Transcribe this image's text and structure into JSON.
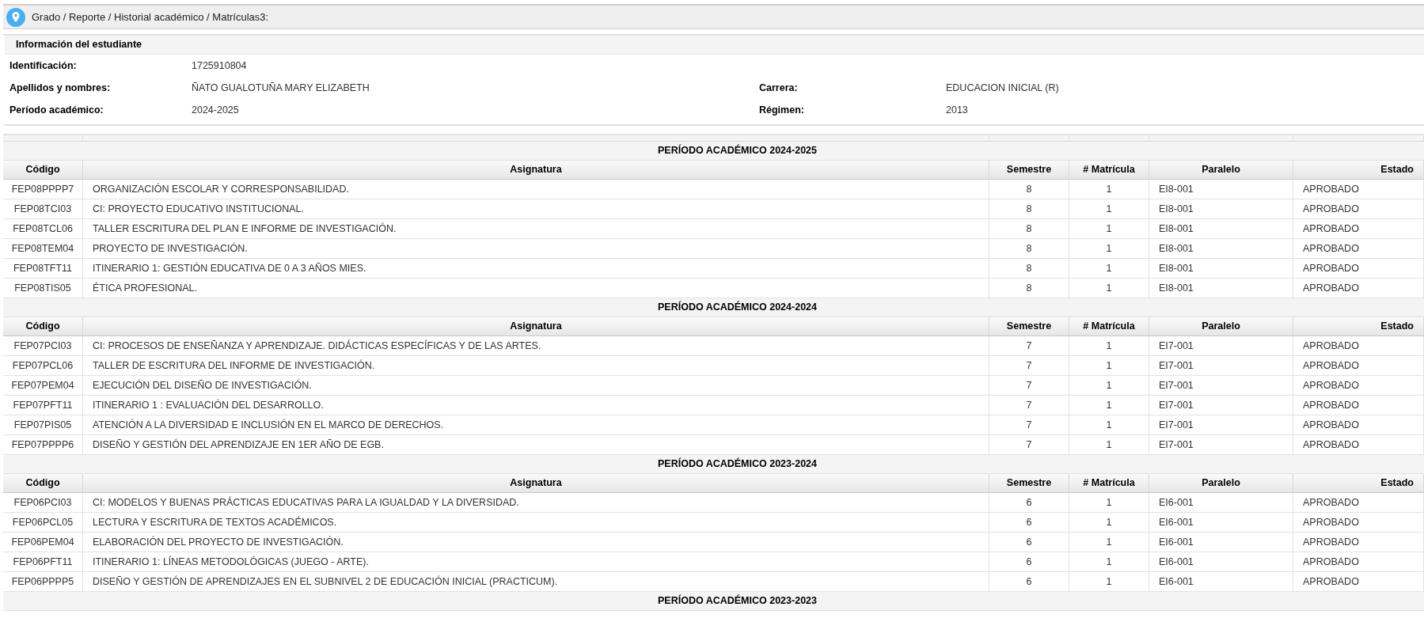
{
  "breadcrumb": "Grado / Reporte / Historial académico / Matrículas3:",
  "student_info": {
    "title": "Información del estudiante",
    "rows": [
      [
        {
          "label": "Identificación:",
          "value": "1725910804"
        }
      ],
      [
        {
          "label": "Apellidos y nombres:",
          "value": "ÑATO GUALOTUÑA MARY ELIZABETH"
        },
        {
          "label": "Carrera:",
          "value": "EDUCACION INICIAL (R)"
        }
      ],
      [
        {
          "label": "Período académico:",
          "value": "2024-2025"
        },
        {
          "label": "Régimen:",
          "value": "2013"
        }
      ]
    ]
  },
  "periods": [
    {
      "title": "PERÍODO ACADÉMICO 2024-2025",
      "columns": [
        "Código",
        "Asignatura",
        "Semestre",
        "# Matrícula",
        "Paralelo",
        "Estado"
      ],
      "rows": [
        [
          "FEP08PPPP7",
          "ORGANIZACIÓN ESCOLAR Y CORRESPONSABILIDAD.",
          "8",
          "1",
          "EI8-001",
          "APROBADO"
        ],
        [
          "FEP08TCI03",
          "CI: PROYECTO EDUCATIVO INSTITUCIONAL.",
          "8",
          "1",
          "EI8-001",
          "APROBADO"
        ],
        [
          "FEP08TCL06",
          "TALLER ESCRITURA DEL PLAN E INFORME DE INVESTIGACIÓN.",
          "8",
          "1",
          "EI8-001",
          "APROBADO"
        ],
        [
          "FEP08TEM04",
          "PROYECTO DE INVESTIGACIÓN.",
          "8",
          "1",
          "EI8-001",
          "APROBADO"
        ],
        [
          "FEP08TFT11",
          "ITINERARIO 1: GESTIÓN EDUCATIVA DE 0 A 3 AÑOS MIES.",
          "8",
          "1",
          "EI8-001",
          "APROBADO"
        ],
        [
          "FEP08TIS05",
          "ÉTICA PROFESIONAL.",
          "8",
          "1",
          "EI8-001",
          "APROBADO"
        ]
      ]
    },
    {
      "title": "PERÍODO ACADÉMICO 2024-2024",
      "columns": [
        "Código",
        "Asignatura",
        "Semestre",
        "# Matrícula",
        "Paralelo",
        "Estado"
      ],
      "rows": [
        [
          "FEP07PCI03",
          "CI: PROCESOS DE ENSEÑANZA Y APRENDIZAJE. DIDÁCTICAS ESPECÍFICAS Y DE LAS ARTES.",
          "7",
          "1",
          "EI7-001",
          "APROBADO"
        ],
        [
          "FEP07PCL06",
          "TALLER DE ESCRITURA DEL INFORME DE INVESTIGACIÓN.",
          "7",
          "1",
          "EI7-001",
          "APROBADO"
        ],
        [
          "FEP07PEM04",
          "EJECUCIÓN DEL DISEÑO DE INVESTIGACIÓN.",
          "7",
          "1",
          "EI7-001",
          "APROBADO"
        ],
        [
          "FEP07PFT11",
          "ITINERARIO 1 : EVALUACIÓN DEL DESARROLLO.",
          "7",
          "1",
          "EI7-001",
          "APROBADO"
        ],
        [
          "FEP07PIS05",
          "ATENCIÓN A LA DIVERSIDAD E INCLUSIÓN EN EL MARCO DE DERECHOS.",
          "7",
          "1",
          "EI7-001",
          "APROBADO"
        ],
        [
          "FEP07PPPP6",
          "DISEÑO Y GESTIÓN DEL APRENDIZAJE EN 1ER AÑO DE EGB.",
          "7",
          "1",
          "EI7-001",
          "APROBADO"
        ]
      ]
    },
    {
      "title": "PERÍODO ACADÉMICO 2023-2024",
      "columns": [
        "Código",
        "Asignatura",
        "Semestre",
        "# Matrícula",
        "Paralelo",
        "Estado"
      ],
      "rows": [
        [
          "FEP06PCI03",
          "CI: MODELOS Y BUENAS PRÁCTICAS EDUCATIVAS PARA LA IGUALDAD Y LA DIVERSIDAD.",
          "6",
          "1",
          "EI6-001",
          "APROBADO"
        ],
        [
          "FEP06PCL05",
          "LECTURA Y ESCRITURA DE TEXTOS ACADÉMICOS.",
          "6",
          "1",
          "EI6-001",
          "APROBADO"
        ],
        [
          "FEP06PEM04",
          "ELABORACIÓN DEL PROYECTO DE INVESTIGACIÓN.",
          "6",
          "1",
          "EI6-001",
          "APROBADO"
        ],
        [
          "FEP06PFT11",
          "ITINERARIO 1: LÍNEAS METODOLÓGICAS (JUEGO - ARTE).",
          "6",
          "1",
          "EI6-001",
          "APROBADO"
        ],
        [
          "FEP06PPPP5",
          "DISEÑO Y GESTIÓN DE APRENDIZAJES EN EL SUBNIVEL 2 DE EDUCACIÓN INICIAL (PRACTICUM).",
          "6",
          "1",
          "EI6-001",
          "APROBADO"
        ]
      ]
    },
    {
      "title": "PERÍODO ACADÉMICO 2023-2023"
    }
  ]
}
